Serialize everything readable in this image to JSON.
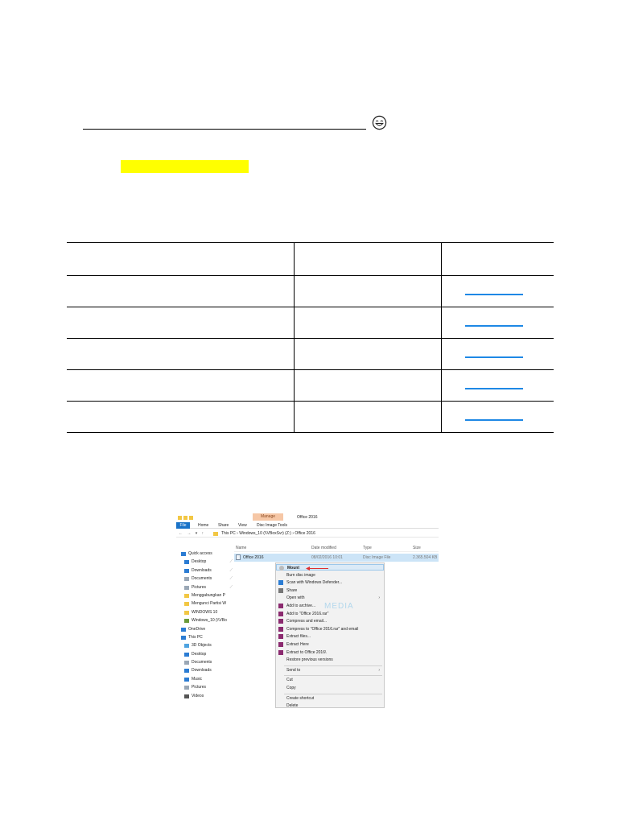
{
  "page": {
    "emoji_icon": "smiling-face-icon",
    "highlight_color": "#ffff00",
    "link_color": "#1e88e5"
  },
  "table": {
    "row_count": 5,
    "column_count": 3
  },
  "screenshot": {
    "title": "Office 2016",
    "manage_tab": "Manage",
    "ribbon_tabs": [
      "File",
      "Home",
      "Share",
      "View",
      "Disc Image Tools"
    ],
    "breadcrumb": "This PC  ›  Windows_10 (\\\\VBoxSvr) (Z:)  ›  Office 2016",
    "nav_arrows": "← → ▾ ↑",
    "columns": {
      "name": "Name",
      "date": "Date modified",
      "type": "Type",
      "size": "Size"
    },
    "file": {
      "name": "Office 2016",
      "date": "08/02/2016 10:01",
      "type": "Disc Image File",
      "size": "2.365.504 KB"
    },
    "nav_pane": [
      {
        "label": "Quick access",
        "icon": "star-icon",
        "indent": false
      },
      {
        "label": "Desktop",
        "icon": "desktop-icon",
        "indent": true,
        "pinned": true
      },
      {
        "label": "Downloads",
        "icon": "download-icon",
        "indent": true,
        "pinned": true
      },
      {
        "label": "Documents",
        "icon": "document-icon",
        "indent": true,
        "pinned": true
      },
      {
        "label": "Pictures",
        "icon": "pictures-icon",
        "indent": true,
        "pinned": true
      },
      {
        "label": "Menggabungkan P",
        "icon": "folder-icon",
        "indent": true
      },
      {
        "label": "Mengunci Partisi W",
        "icon": "folder-icon",
        "indent": true
      },
      {
        "label": "WINDOWS 10",
        "icon": "folder-icon",
        "indent": true
      },
      {
        "label": "Windows_10 (\\\\VBo",
        "icon": "network-drive-icon",
        "indent": true
      },
      {
        "label": "OneDrive",
        "icon": "cloud-icon",
        "indent": false
      },
      {
        "label": "This PC",
        "icon": "computer-icon",
        "indent": false
      },
      {
        "label": "3D Objects",
        "icon": "cube-icon",
        "indent": true
      },
      {
        "label": "Desktop",
        "icon": "desktop-icon",
        "indent": true
      },
      {
        "label": "Documents",
        "icon": "document-icon",
        "indent": true
      },
      {
        "label": "Downloads",
        "icon": "download-icon",
        "indent": true
      },
      {
        "label": "Music",
        "icon": "music-icon",
        "indent": true
      },
      {
        "label": "Pictures",
        "icon": "pictures-icon",
        "indent": true
      },
      {
        "label": "Videos",
        "icon": "video-icon",
        "indent": true
      }
    ],
    "context_menu": [
      {
        "label": "Mount",
        "icon": "disc-icon",
        "bold": true,
        "highlighted": true
      },
      {
        "label": "Burn disc image"
      },
      {
        "label": "Scan with Windows Defender...",
        "icon": "shield-icon"
      },
      {
        "label": "Share",
        "icon": "share-icon"
      },
      {
        "label": "Open with",
        "submenu": true
      },
      {
        "label": "Add to archive...",
        "icon": "archive-icon"
      },
      {
        "label": "Add to \"Office 2016.rar\"",
        "icon": "archive-icon"
      },
      {
        "label": "Compress and email...",
        "icon": "archive-icon"
      },
      {
        "label": "Compress to \"Office 2016.rar\" and email",
        "icon": "archive-icon"
      },
      {
        "label": "Extract files...",
        "icon": "archive-icon"
      },
      {
        "label": "Extract Here",
        "icon": "archive-icon"
      },
      {
        "label": "Extract to Office 2016\\",
        "icon": "archive-icon"
      },
      {
        "label": "Restore previous versions"
      },
      {
        "label": "Send to",
        "submenu": true,
        "separator_before": true
      },
      {
        "label": "Cut",
        "separator_before": true
      },
      {
        "label": "Copy"
      },
      {
        "label": "Create shortcut",
        "separator_before": true
      },
      {
        "label": "Delete"
      }
    ],
    "watermark": "MEDIA"
  }
}
